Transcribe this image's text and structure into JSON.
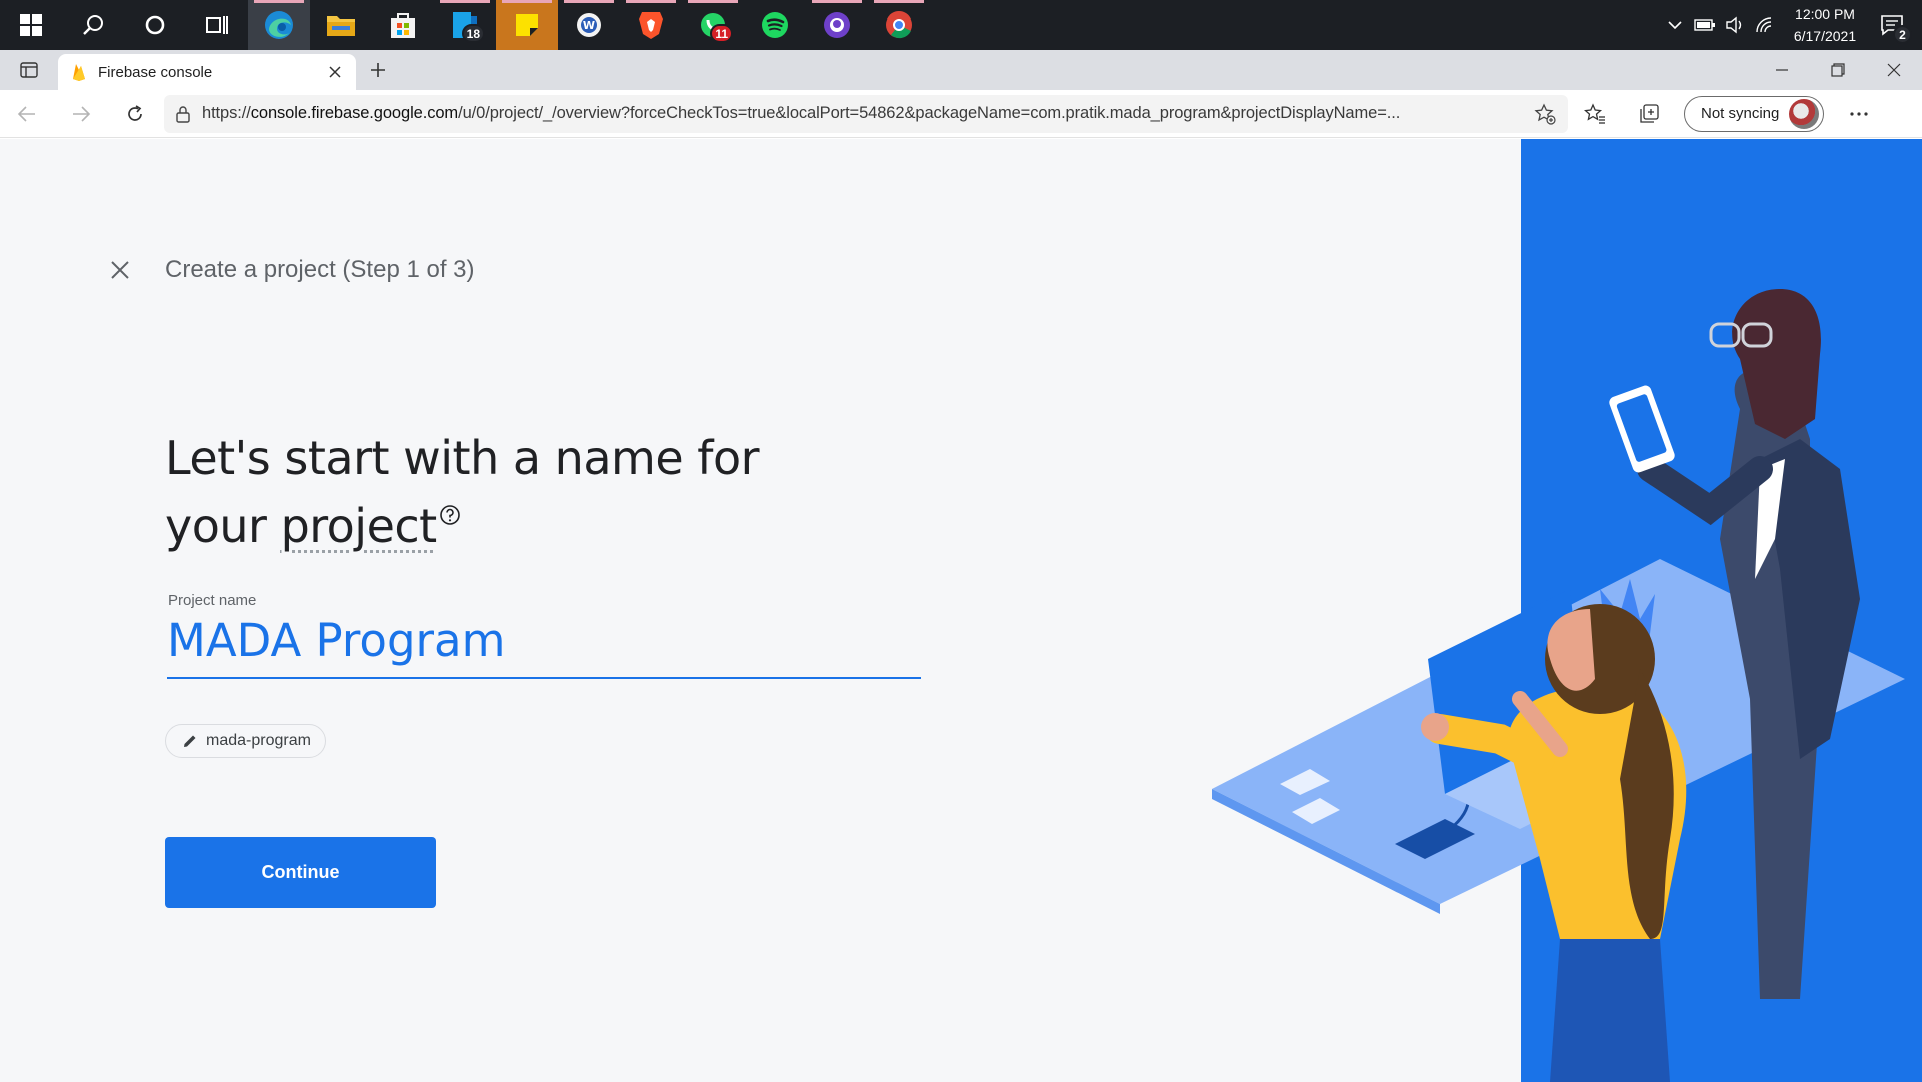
{
  "taskbar": {
    "apps": [
      {
        "name": "windows-start",
        "badge": ""
      },
      {
        "name": "search",
        "badge": ""
      },
      {
        "name": "cortana",
        "badge": ""
      },
      {
        "name": "task-view",
        "badge": ""
      },
      {
        "name": "edge",
        "badge": ""
      },
      {
        "name": "file-explorer",
        "badge": ""
      },
      {
        "name": "microsoft-store",
        "badge": ""
      },
      {
        "name": "mail-calendar",
        "badge": "18"
      },
      {
        "name": "sticky-notes",
        "badge": ""
      },
      {
        "name": "word-app",
        "badge": ""
      },
      {
        "name": "brave",
        "badge": ""
      },
      {
        "name": "whatsapp",
        "badge": "11"
      },
      {
        "name": "spotify",
        "badge": ""
      },
      {
        "name": "github-desktop",
        "badge": ""
      },
      {
        "name": "chrome",
        "badge": ""
      }
    ],
    "clock_time": "12:00 PM",
    "clock_date": "6/17/2021",
    "notification_count": "2"
  },
  "browser": {
    "tab_title": "Firebase console",
    "url_prefix": "https://",
    "url_host": "console.firebase.google.com",
    "url_rest": "/u/0/project/_/overview?forceCheckTos=true&localPort=54862&packageName=com.pratik.mada_program&projectDisplayName=...",
    "sync_label": "Not syncing"
  },
  "page": {
    "step_title": "Create a project (Step 1 of 3)",
    "headline_line1": "Let's start with a name for",
    "headline_line2_prefix": "your ",
    "headline_line2_word": "project",
    "field_label": "Project name",
    "project_name": "MADA Program",
    "project_id": "mada-program",
    "continue_label": "Continue"
  },
  "colors": {
    "accent": "#1a73e8",
    "page_bg": "#f6f7f9",
    "taskbar_bg": "#1c1f24"
  }
}
